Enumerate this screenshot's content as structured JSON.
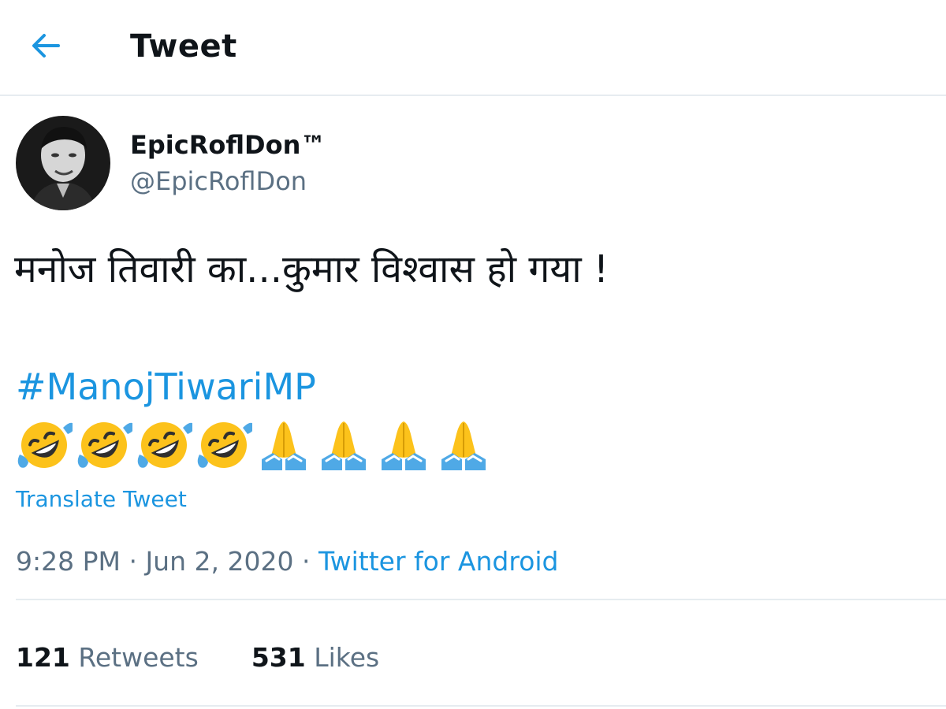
{
  "header": {
    "back_icon": "arrow-left-icon",
    "title": "Tweet"
  },
  "tweet": {
    "author": {
      "display_name": "EpicRoflDon™",
      "handle": "@EpicRoflDon",
      "avatar": "profile-photo"
    },
    "text": "मनोज तिवारी का...कुमार विश्वास हो गया !",
    "hashtag": "#ManojTiwariMP",
    "emojis": [
      "rolling-on-floor-laughing",
      "rolling-on-floor-laughing",
      "rolling-on-floor-laughing",
      "rolling-on-floor-laughing",
      "folded-hands",
      "folded-hands",
      "folded-hands",
      "folded-hands"
    ],
    "translate_label": "Translate Tweet",
    "time": "9:28 PM",
    "separator": " · ",
    "date": "Jun 2, 2020",
    "source": "Twitter for Android",
    "retweets_count": "121",
    "retweets_label": "Retweets",
    "likes_count": "531",
    "likes_label": "Likes"
  },
  "colors": {
    "accent": "#1b95e0",
    "secondary_text": "#5b7083",
    "primary_text": "#0f1419",
    "divider": "#e6ecf0",
    "emoji_face": "#fcc21b",
    "emoji_tears": "#4fa9e6"
  }
}
